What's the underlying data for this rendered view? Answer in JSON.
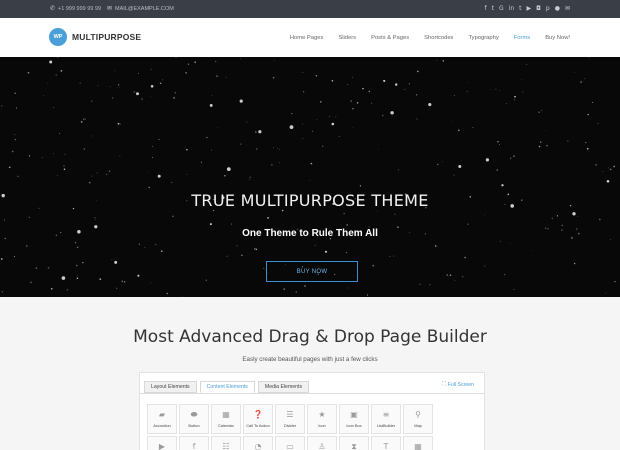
{
  "topbar": {
    "phone": "+1 999 999 99 99",
    "email": "MAIL@EXAMPLE.COM",
    "social_icons": [
      "facebook-icon",
      "twitter-icon",
      "google-icon",
      "linkedin-icon",
      "tumblr-icon",
      "youtube-icon",
      "instagram-icon",
      "pinterest-icon",
      "flickr-icon",
      "envelope-icon"
    ]
  },
  "header": {
    "logo_mark": "WP",
    "logo_text": "MULTIPURPOSE",
    "nav": [
      "Home Pages",
      "Sliders",
      "Posts & Pages",
      "Shortcodes",
      "Typography",
      "Forms",
      "Buy Now!"
    ],
    "active_nav": "Forms",
    "accent_color": "#4a9fd8"
  },
  "hero": {
    "title": "TRUE MULTIPURPOSE THEME",
    "subtitle": "One Theme to Rule Them All",
    "button": "BUY NOW"
  },
  "builder_section": {
    "title": "Most Advanced Drag & Drop Page Builder",
    "subtitle": "Easly create beautiful pages with just a few clicks",
    "tabs": [
      "Layout Elements",
      "Content Elements",
      "Media Elements"
    ],
    "active_tab": "Content Elements",
    "fullscreen": "Full Screen",
    "elements": [
      {
        "label": "Accordion",
        "icon": "accordion-icon"
      },
      {
        "label": "Button",
        "icon": "button-icon"
      },
      {
        "label": "Calendar",
        "icon": "calendar-icon"
      },
      {
        "label": "Call To Action",
        "icon": "call-to-action-icon"
      },
      {
        "label": "Divider",
        "icon": "divider-icon"
      },
      {
        "label": "Icon",
        "icon": "star-icon"
      },
      {
        "label": "Icon Box",
        "icon": "icon-box-icon"
      },
      {
        "label": "ListBuilder",
        "icon": "list-icon"
      },
      {
        "label": "Map",
        "icon": "map-marker-icon"
      },
      {
        "label": "",
        "icon": "play-icon"
      },
      {
        "label": "",
        "icon": "facebook-icon"
      },
      {
        "label": "",
        "icon": "rows-icon"
      },
      {
        "label": "",
        "icon": "rss-icon"
      },
      {
        "label": "",
        "icon": "tabs-icon"
      },
      {
        "label": "",
        "icon": "user-icon"
      },
      {
        "label": "",
        "icon": "hourglass-icon"
      },
      {
        "label": "",
        "icon": "text-icon"
      },
      {
        "label": "",
        "icon": "grid-icon"
      }
    ]
  }
}
